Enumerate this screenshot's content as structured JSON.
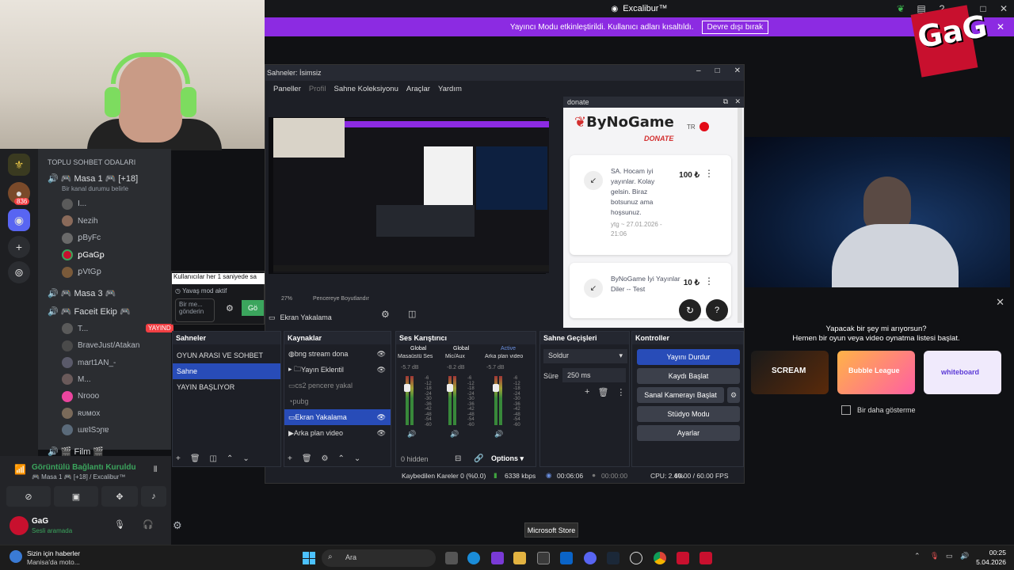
{
  "window": {
    "title": "Excalibur™"
  },
  "banner": {
    "text": "Yayıncı Modu etkinleştirildi. Kullanıcı adları kısaltıldı.",
    "button": "Devre dışı bırak"
  },
  "discord": {
    "section_header": "TOPLU SOHBET ODALARI",
    "badge": "836",
    "channels": [
      {
        "label": "🎮 Masa 1 🎮 [+18]",
        "sub": "Bir kanal durumu belirle"
      },
      {
        "label": "🎮 Masa 3 🎮"
      },
      {
        "label": "🎮 Faceit Ekip 🎮"
      },
      {
        "label": "🎬 Film 🎬"
      }
    ],
    "users_masa1": [
      "I...",
      "Nezih",
      "ꝑBуFᴄ",
      "ꝑGaGꝑ",
      "ꝑVtGꝑ"
    ],
    "users_faceit": [
      "T...",
      "BraveJust/Atakan",
      "mart1AN_-",
      "M...",
      "Nrooo",
      "ʀᴜᴍᴏx",
      "ɯɐʇSɔɲɐ"
    ],
    "faceit_badge": "YAYIND",
    "voice_status": "Görüntülü Bağlantı Kuruldu",
    "voice_sub": "🎮 Masa 1 🎮 [+18] / Excalibur™",
    "user_name": "GaG",
    "user_status": "Sesli aramada",
    "slowmode_tooltip": "Kullanıcılar her 1 saniyede sa",
    "slowmode_label": "Yavaş mod aktif",
    "msg_placeholder": "Bir me... gönderin",
    "send_label": "Gö"
  },
  "obs": {
    "title": "Sahneler: İsimsiz",
    "menu": [
      "Paneller",
      "Profil",
      "Sahne Koleksiyonu",
      "Araçlar",
      "Yardım"
    ],
    "zoom": "27%",
    "fit_label": "Pencereye Boyutlandır",
    "source_label": "Ekran Yakalama",
    "docks": {
      "scenes": {
        "title": "Sahneler",
        "items": [
          "OYUN ARASI VE SOHBET",
          "Sahne",
          "YAYIN BAŞLIYOR"
        ],
        "selected": 1
      },
      "sources": {
        "title": "Kaynaklar",
        "items": [
          "bng stream dona",
          "Yayın Eklentil",
          "cs2 pencere yakal",
          "pubg",
          "Ekran Yakalama",
          "Arka plan video"
        ],
        "selected": 4
      },
      "mixer": {
        "title": "Ses Karıştırıcı",
        "channels": [
          {
            "tag": "Global",
            "name": "Masaüstü Ses",
            "db": "-5.7 dB"
          },
          {
            "tag": "Global",
            "name": "Mic/Aux",
            "db": "-8.2 dB"
          },
          {
            "tag": "Active",
            "name": "Arka plan video",
            "db": "-5.7 dB"
          }
        ],
        "scale": [
          "-6",
          "-12",
          "-18",
          "-24",
          "-30",
          "-36",
          "-42",
          "-48",
          "-54",
          "-60"
        ],
        "hidden": "0 hidden",
        "options": "Options"
      },
      "transitions": {
        "title": "Sahne Geçişleri",
        "type": "Soldur",
        "duration_label": "Süre",
        "duration": "250 ms"
      },
      "controls": {
        "title": "Kontroller",
        "buttons": [
          "Yayını Durdur",
          "Kaydı Başlat",
          "Sanal Kamerayı Başlat",
          "Stüdyo Modu",
          "Ayarlar"
        ]
      }
    },
    "status": {
      "dropped": "Kaybedilen Kareler 0 (%0.0)",
      "bitrate": "6338 kbps",
      "stream_time": "00:06:06",
      "rec_time": "00:00:00",
      "cpu": "CPU: 2.4%",
      "fps": "60.00 / 60.00 FPS"
    }
  },
  "donate": {
    "title": "donate",
    "brand": "ByNoGame",
    "brand_sub": "DONATE",
    "lang": "TR",
    "cards": [
      {
        "msg": "SA. Hocam iyi yayınlar. Kolay gelsin. Biraz botsunuz ama hoşsunuz.",
        "meta": "ytg ~ 27.01.2026 - 21:06",
        "amount": "100 ₺"
      },
      {
        "msg": "ByNoGame İyi Yayınlar Diler -- Test",
        "amount": "10 ₺"
      }
    ]
  },
  "suggest": {
    "question": "Yapacak bir şey mi arıyorsun?",
    "sub": "Hemen bir oyun veya video oynatma listesi başlat.",
    "thumbs": [
      "SCREAM",
      "Bubble League",
      "whiteboard"
    ],
    "dont_show": "Bir daha gösterme"
  },
  "tooltip": "Microsoft Store",
  "taskbar": {
    "news_title": "Sizin için haberler",
    "news_sub": "Manisa'da moto...",
    "search": "Ara",
    "time": "00:25",
    "date": "5.04.2026"
  }
}
